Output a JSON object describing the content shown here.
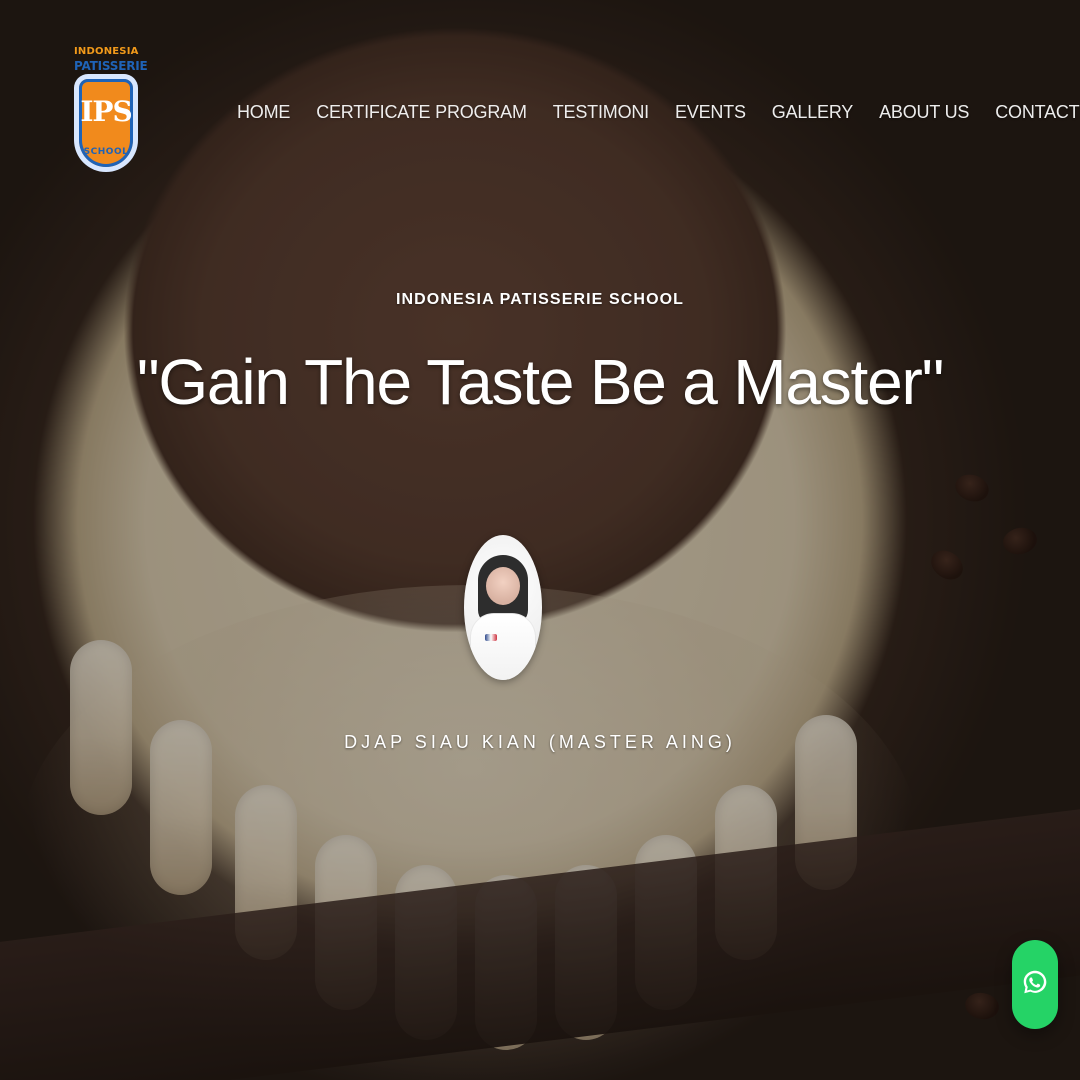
{
  "brand": {
    "logo_line1": "INDONESIA",
    "logo_line2": "PATISSERIE",
    "logo_mark": "IPS",
    "logo_school": "SCHOOL",
    "accent_orange": "#f18a1c",
    "accent_blue": "#1f63b7"
  },
  "nav": {
    "items": [
      {
        "label": "HOME"
      },
      {
        "label": "CERTIFICATE PROGRAM"
      },
      {
        "label": "TESTIMONI"
      },
      {
        "label": "EVENTS"
      },
      {
        "label": "GALLERY"
      },
      {
        "label": "ABOUT US"
      },
      {
        "label": "CONTACT"
      }
    ]
  },
  "hero": {
    "eyebrow": "INDONESIA PATISSERIE SCHOOL",
    "headline": "\"Gain The Taste Be a Master\"",
    "person_name": "DJAP SIAU KIAN (MASTER AING)"
  },
  "floating": {
    "whatsapp_icon": "whatsapp-icon",
    "whatsapp_color": "#25d366"
  }
}
